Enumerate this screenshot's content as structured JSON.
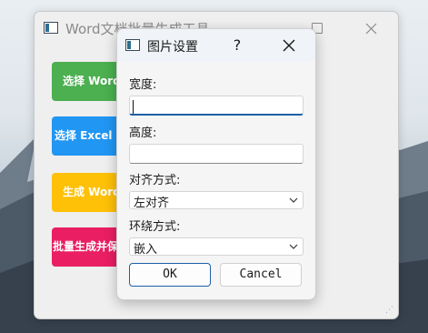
{
  "main_window": {
    "title": "Word文档批量生成工具",
    "buttons": {
      "select_word": "选择 Word",
      "select_excel": "选择 Excel",
      "generate_word": "生成 Word",
      "batch_generate": "批量生成并保"
    }
  },
  "dialog": {
    "title": "图片设置",
    "help": "?",
    "width_label": "宽度:",
    "width_value": "",
    "height_label": "高度:",
    "height_value": "",
    "align_label": "对齐方式:",
    "align_value": "左对齐",
    "wrap_label": "环绕方式:",
    "wrap_value": "嵌入",
    "ok_label": "OK",
    "cancel_label": "Cancel"
  }
}
